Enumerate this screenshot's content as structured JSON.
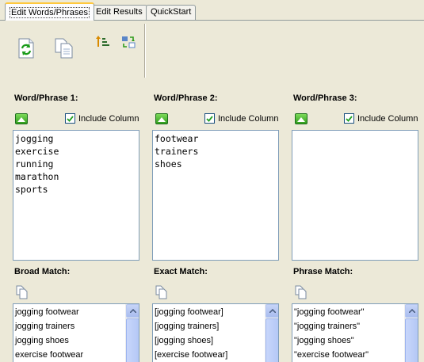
{
  "tabs": [
    {
      "label": "Edit Words/Phrases",
      "active": true
    },
    {
      "label": "Edit Results",
      "active": false
    },
    {
      "label": "QuickStart",
      "active": false
    }
  ],
  "toolbar": {
    "icons": [
      "refresh-icon",
      "copy-icon",
      "sort-icon",
      "swap-icon"
    ]
  },
  "columns": [
    {
      "label": "Word/Phrase 1:",
      "include_label": "Include Column",
      "include_checked": true,
      "words": [
        "jogging",
        "exercise",
        "running",
        "marathon",
        "sports"
      ]
    },
    {
      "label": "Word/Phrase 2:",
      "include_label": "Include Column",
      "include_checked": true,
      "words": [
        "footwear",
        "trainers",
        "shoes"
      ]
    },
    {
      "label": "Word/Phrase 3:",
      "include_label": "Include Column",
      "include_checked": true,
      "words": []
    }
  ],
  "matches": [
    {
      "label": "Broad Match:",
      "items": [
        "jogging footwear",
        "jogging trainers",
        "jogging shoes",
        "exercise footwear"
      ]
    },
    {
      "label": "Exact Match:",
      "items": [
        "[jogging footwear]",
        "[jogging trainers]",
        "[jogging shoes]",
        "[exercise footwear]"
      ]
    },
    {
      "label": "Phrase Match:",
      "items": [
        "\"jogging footwear\"",
        "\"jogging trainers\"",
        "\"jogging shoes\"",
        "\"exercise footwear\""
      ]
    }
  ]
}
